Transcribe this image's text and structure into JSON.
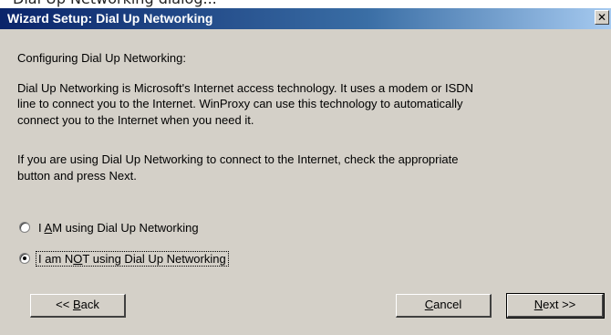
{
  "caption_fragment": "Dial Up Networking dialog...",
  "window": {
    "title": "Wizard Setup: Dial Up Networking",
    "close_glyph": "✕"
  },
  "content": {
    "heading": "Configuring Dial Up Networking:",
    "paragraph1": [
      "Dial Up Networking is Microsoft's Internet access technology.  It uses a modem or ISDN",
      "line to connect you to the Internet.  WinProxy can use this technology to automatically",
      "connect you to the Internet when you need it."
    ],
    "paragraph2": [
      "If you are using Dial Up Networking to connect to the Internet, check the appropriate",
      "button and press Next."
    ]
  },
  "options": [
    {
      "label_before": "I ",
      "label_mnemonic": "A",
      "label_after": "M using Dial Up Networking",
      "checked": false
    },
    {
      "label_before": "I am N",
      "label_mnemonic": "O",
      "label_after": "T using Dial Up Networking",
      "checked": true
    }
  ],
  "buttons": {
    "back_prefix": "<< ",
    "back_mnemonic": "B",
    "back_rest": "ack",
    "cancel_mnemonic": "C",
    "cancel_rest": "ancel",
    "next_mnemonic": "N",
    "next_rest": "ext >>"
  },
  "colors": {
    "titlebar_start": "#0a246a",
    "titlebar_end": "#a6caf0",
    "dialog_face": "#d4d0c8"
  }
}
